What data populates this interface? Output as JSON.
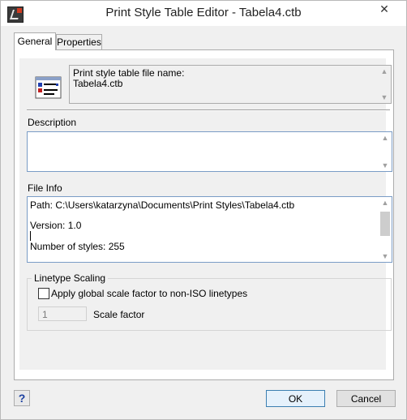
{
  "window": {
    "title": "Print Style Table Editor - Tabela4.ctb",
    "close_glyph": "✕",
    "app_icon": "autocad-app-icon"
  },
  "tabs": [
    {
      "label": "General",
      "selected": true
    },
    {
      "label": "Properties",
      "selected": false
    }
  ],
  "file_name_box": {
    "icon": "print-style-table-icon",
    "label": "Print style table file name:",
    "value": "Tabela4.ctb"
  },
  "description": {
    "label": "Description",
    "value": ""
  },
  "file_info": {
    "label": "File Info",
    "path": "Path: C:\\Users\\katarzyna\\Documents\\Print Styles\\Tabela4.ctb",
    "version": "Version: 1.0",
    "styles": "Number of styles: 255"
  },
  "linetype_scaling": {
    "label": "Linetype Scaling",
    "checkbox_label": "Apply global scale factor to non-ISO linetypes",
    "checked": false,
    "scale_value": "1",
    "scale_label": "Scale factor"
  },
  "buttons": {
    "help": "?",
    "ok": "OK",
    "cancel": "Cancel"
  },
  "scroll_glyphs": {
    "up": "▲",
    "down": "▼"
  },
  "colors": {
    "accent_border": "#7a9cc6",
    "default_button_border": "#3c7fb1",
    "dialog_bg": "#f0f0f0"
  }
}
